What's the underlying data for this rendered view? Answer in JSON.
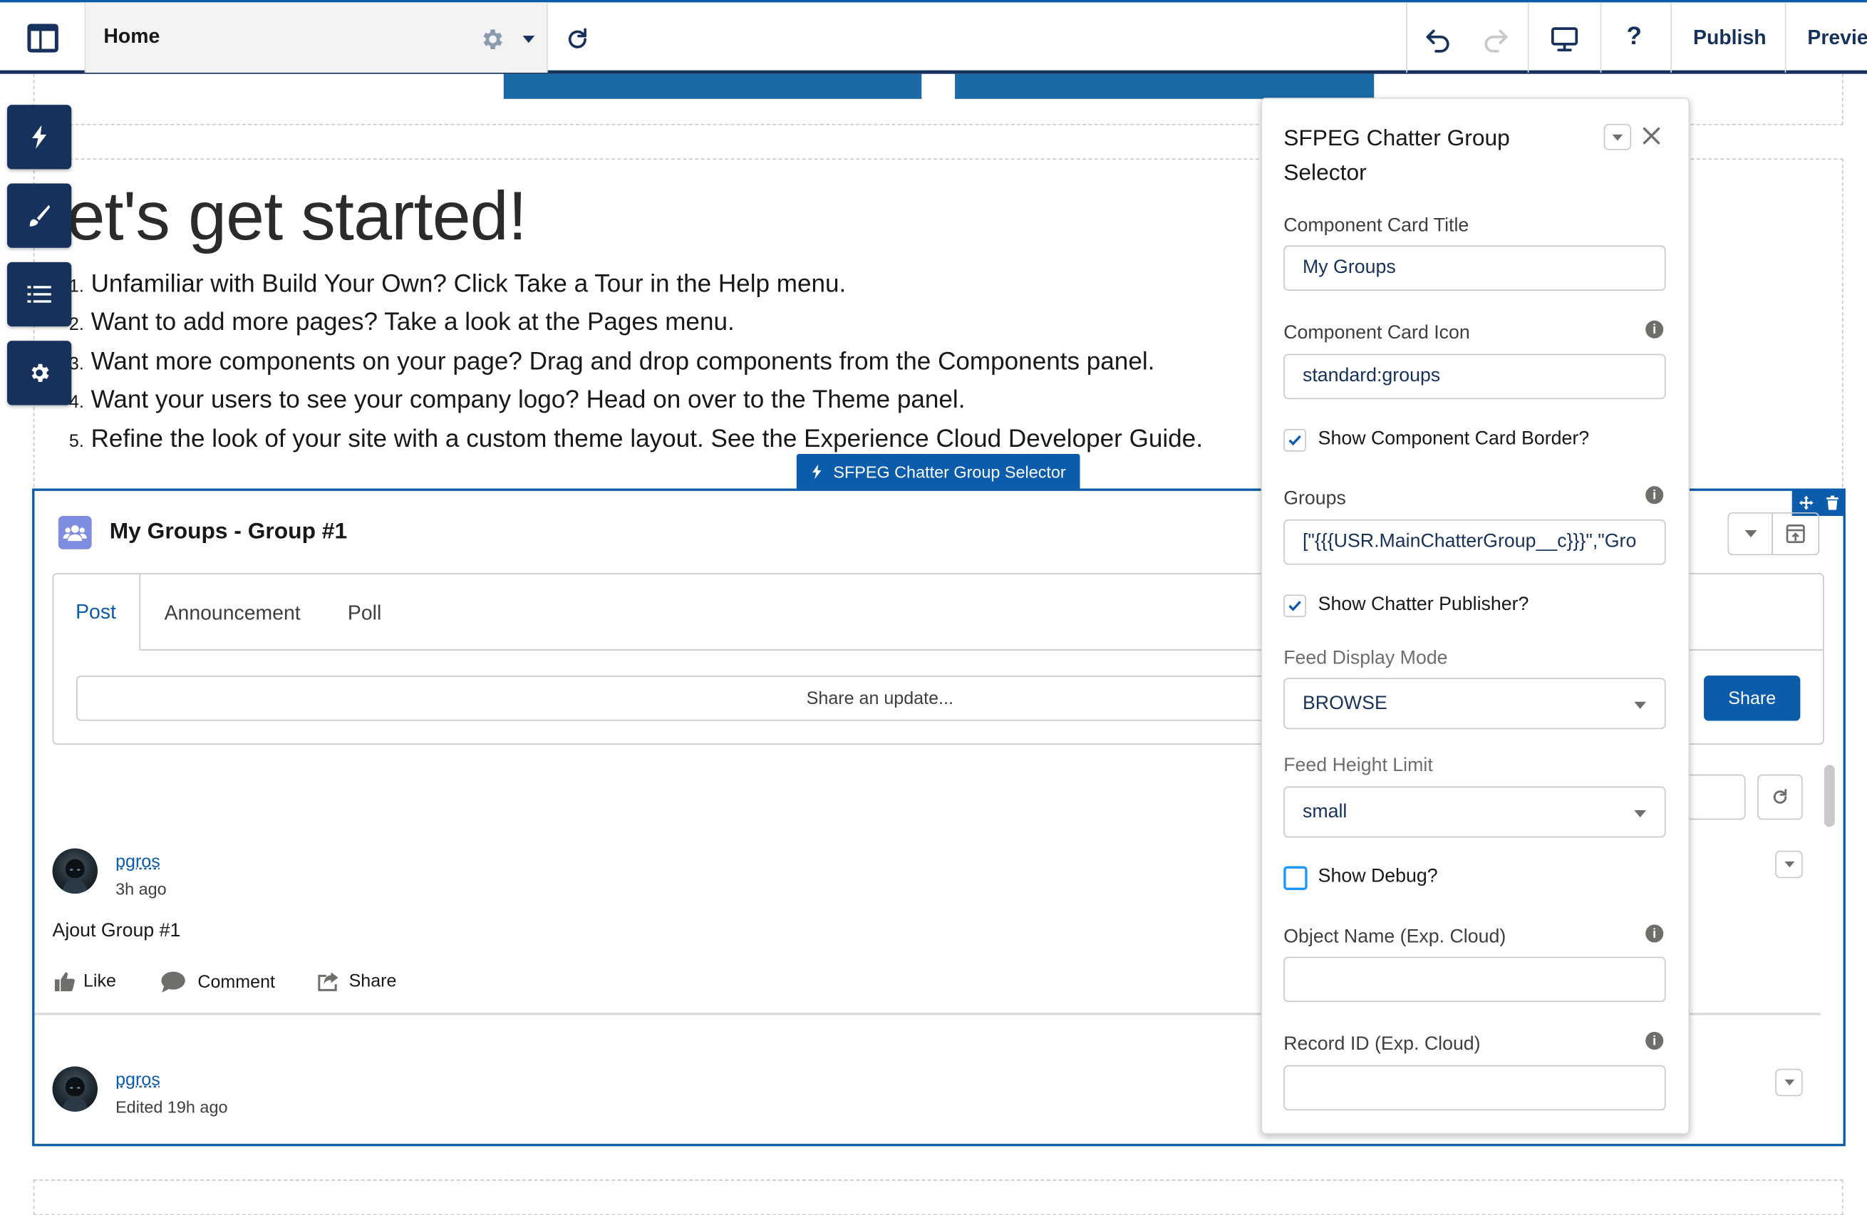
{
  "topbar": {
    "page_name": "Home",
    "help_label": "?",
    "publish_label": "Publish",
    "preview_label": "Previe"
  },
  "canvas": {
    "headline": "et's get started!",
    "steps": [
      {
        "num": "1.",
        "text": "Unfamiliar with Build Your Own? Click Take a Tour in the Help menu."
      },
      {
        "num": "2.",
        "text": "Want to add more pages? Take a look at the Pages menu."
      },
      {
        "num": "3.",
        "text": "Want more components on your page? Drag and drop components from the Components panel."
      },
      {
        "num": "4.",
        "text": "Want your users to see your company logo? Head on over to the Theme panel."
      },
      {
        "num": "5.",
        "text": "Refine the look of your site with a custom theme layout. See the Experience Cloud Developer Guide."
      }
    ]
  },
  "sidebar": {
    "items": [
      {
        "icon": "lightning-icon"
      },
      {
        "icon": "brush-icon"
      },
      {
        "icon": "list-icon"
      },
      {
        "icon": "gear-icon"
      }
    ]
  },
  "component": {
    "label": "SFPEG Chatter Group Selector",
    "card_title": "My Groups - Group #1",
    "card_icon": "groups-icon",
    "publisher": {
      "tabs": [
        "Post",
        "Announcement",
        "Poll"
      ],
      "active_tab": "Post",
      "share_placeholder": "Share an update...",
      "share_button": "Share"
    },
    "feed": [
      {
        "author": "pgros",
        "time": "3h ago",
        "body": "Ajout Group #1",
        "actions": [
          "Like",
          "Comment",
          "Share"
        ]
      },
      {
        "author": "pgros",
        "time": "Edited 19h ago"
      }
    ]
  },
  "panel": {
    "title": "SFPEG Chatter Group Selector",
    "fields": {
      "card_title_label": "Component Card Title",
      "card_title_value": "My Groups",
      "card_icon_label": "Component Card Icon",
      "card_icon_value": "standard:groups",
      "show_border_label": "Show Component Card Border?",
      "show_border": true,
      "groups_label": "Groups",
      "groups_value": "[\"{{{USR.MainChatterGroup__c}}}\",\"Gro",
      "show_publisher_label": "Show Chatter Publisher?",
      "show_publisher": true,
      "display_mode_label": "Feed Display Mode",
      "display_mode_value": "BROWSE",
      "height_limit_label": "Feed Height Limit",
      "height_limit_value": "small",
      "show_debug_label": "Show Debug?",
      "show_debug": false,
      "object_name_label": "Object Name (Exp. Cloud)",
      "object_name_value": "",
      "record_id_label": "Record ID (Exp. Cloud)",
      "record_id_value": ""
    },
    "info_glyph": "i"
  },
  "colors": {
    "brand_blue": "#0b5cab",
    "navy": "#16325c",
    "banner_blue": "#1b6aa5",
    "group_icon_bg": "#7f8de1"
  }
}
